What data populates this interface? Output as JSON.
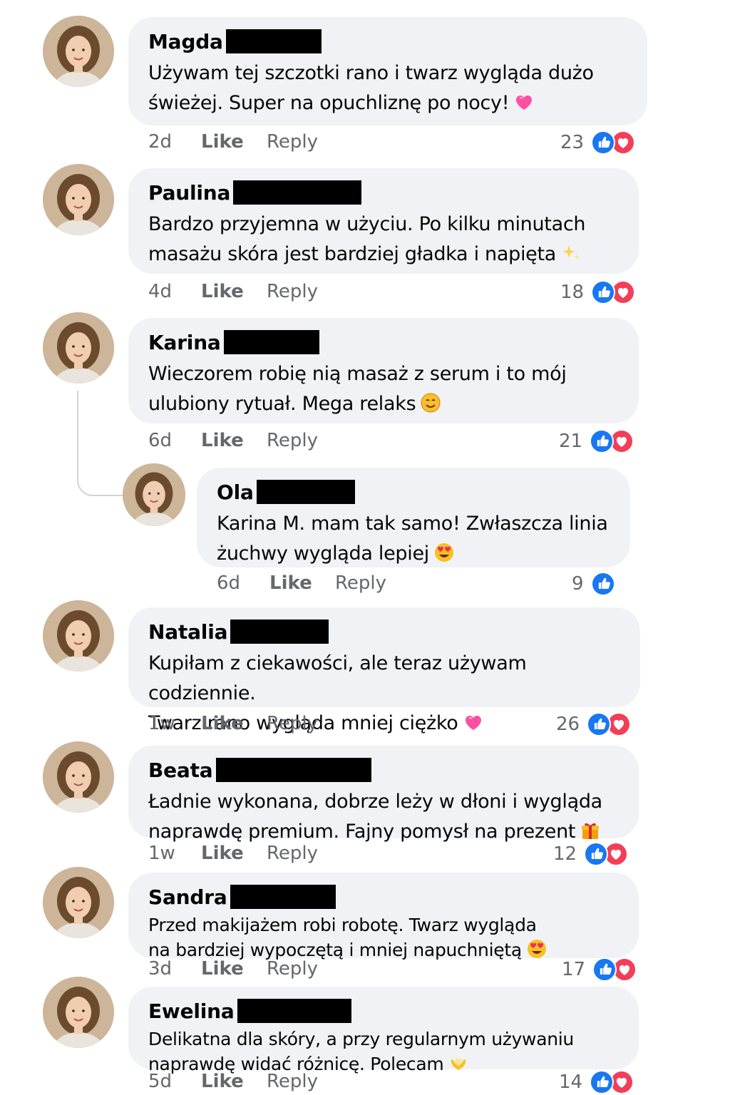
{
  "comments": [
    {
      "name": "Magda",
      "text": "Używam tej szczotki rano i twarz wygląda dużo świeżej. Super na opuchliznę po nocy!",
      "emoji": "pink-heart-icon",
      "time": "2d",
      "like": "Like",
      "reply": "Reply",
      "count": "23",
      "reactions": [
        "like",
        "love"
      ]
    },
    {
      "name": "Paulina",
      "text": "Bardzo przyjemna w użyciu. Po kilku minutach masażu skóra jest bardziej gładka i napięta",
      "emoji": "sparkles-icon",
      "time": "4d",
      "like": "Like",
      "reply": "Reply",
      "count": "18",
      "reactions": [
        "like",
        "love"
      ]
    },
    {
      "name": "Karina",
      "text": "Wieczorem robię nią masaż z serum i to mój ulubiony rytuał. Mega relaks",
      "emoji": "smile-icon",
      "time": "6d",
      "like": "Like",
      "reply": "Reply",
      "count": "21",
      "reactions": [
        "like",
        "love"
      ]
    },
    {
      "name": "Ola",
      "text": "Karina M. mam tak samo! Zwłaszcza linia żuchwy wygląda lepiej",
      "emoji": "heart-eyes-icon",
      "time": "6d",
      "like": "Like",
      "reply": "Reply",
      "count": "9",
      "reactions": [
        "like"
      ]
    },
    {
      "name": "Natalia",
      "text": "Kupiłam z ciekawości, ale teraz używam codziennie. Twarz rano wygląda mniej ciężko",
      "emoji": "pink-heart-icon",
      "time": "1w",
      "like": "Like",
      "reply": "Reply",
      "count": "26",
      "reactions": [
        "like",
        "love"
      ]
    },
    {
      "name": "Beata",
      "text": "Ładnie wykonana, dobrze leży w dłoni i wygląda naprawdę premium. Fajny pomysł na prezent",
      "emoji": "gift-icon",
      "time": "1w",
      "like": "Like",
      "reply": "Reply",
      "count": "12",
      "reactions": [
        "like",
        "love"
      ]
    },
    {
      "name": "Sandra",
      "text": "Przed makijażem robi robotę. Twarz wygląda na bardziej wypoczętą i mniej napuchniętą",
      "emoji": "heart-eyes-icon",
      "time": "3d",
      "like": "Like",
      "reply": "Reply",
      "count": "17",
      "reactions": [
        "like",
        "love"
      ]
    },
    {
      "name": "Ewelina",
      "text": "Delikatna dla skóry, a przy regularnym używaniu naprawdę widać różnicę. Polecam",
      "emoji": "heart-hands-icon",
      "time": "5d",
      "like": "Like",
      "reply": "Reply",
      "count": "14",
      "reactions": [
        "like",
        "love"
      ]
    }
  ],
  "lines": [
    [
      "Używam tej szczotki rano i twarz wygląda dużo",
      "świeżej. Super na opuchliznę po nocy!"
    ],
    [
      "Bardzo przyjemna w użyciu. Po kilku minutach",
      "masażu skóra jest bardziej gładka i napięta"
    ],
    [
      "Wieczorem robię nią masaż z serum i to mój",
      "ulubiony rytuał. Mega relaks"
    ],
    [
      "Karina M. mam tak samo! Zwłaszcza linia",
      "żuchwy wygląda lepiej"
    ],
    [
      "Kupiłam z ciekawości, ale teraz używam codziennie.",
      "Twarz rano wygląda mniej ciężko"
    ],
    [
      "Ładnie wykonana, dobrze leży w dłoni i wygląda",
      "naprawdę premium. Fajny pomysł na prezent"
    ],
    [
      "Przed makijażem robi robotę. Twarz wygląda",
      "na bardziej wypoczętą i mniej napuchniętą"
    ],
    [
      "Delikatna dla skóry, a przy regularnym używaniu",
      "naprawdę widać różnicę. Polecam"
    ]
  ],
  "colors": {
    "bubble": "#f0f2f5",
    "meta": "#65676b",
    "like_blue": "#1877f2",
    "love_red": "#f33e58"
  }
}
